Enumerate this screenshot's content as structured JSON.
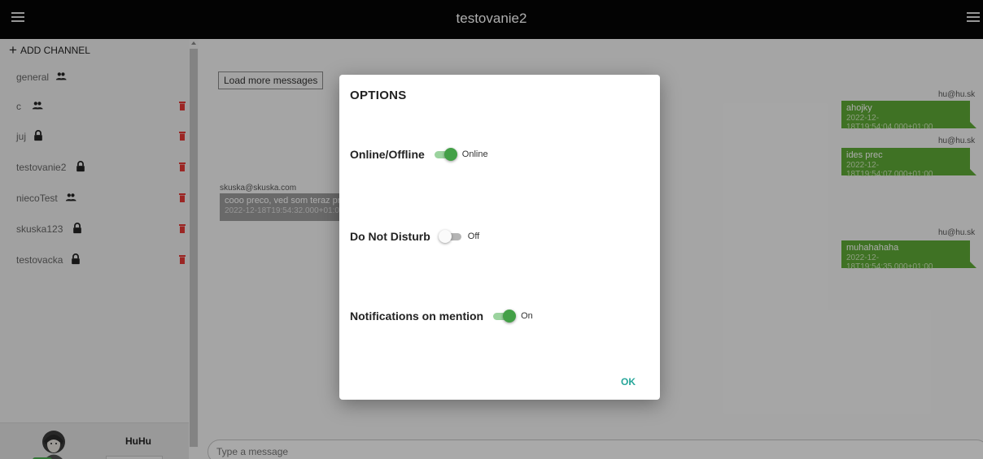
{
  "header": {
    "title": "testovanie2"
  },
  "sidebar": {
    "add_channel_label": "ADD CHANNEL",
    "channels": [
      {
        "name": "general",
        "icon": "group-icon",
        "deletable": false
      },
      {
        "name": "c",
        "icon": "group-icon",
        "deletable": true
      },
      {
        "name": "juj",
        "icon": "lock-icon",
        "deletable": true
      },
      {
        "name": "testovanie2",
        "icon": "lock-icon",
        "deletable": true
      },
      {
        "name": "niecoTest",
        "icon": "group-icon",
        "deletable": true
      },
      {
        "name": "skuska123",
        "icon": "lock-icon",
        "deletable": true
      },
      {
        "name": "testovacka",
        "icon": "lock-icon",
        "deletable": true
      }
    ],
    "user": {
      "name": "HuHu"
    }
  },
  "chat": {
    "load_more_label": "Load more messages",
    "messages": [
      {
        "author": "skuska@skuska.com",
        "text": "cooo preco, ved som teraz pr",
        "time": "2022-12-18T19:54:32.000+01:0",
        "side": "left"
      },
      {
        "author": "hu@hu.sk",
        "text": "ahojky",
        "time": "2022-12-18T19:54:04.000+01:00",
        "side": "right"
      },
      {
        "author": "hu@hu.sk",
        "text": "ides prec",
        "time": "2022-12-18T19:54:07.000+01:00",
        "side": "right"
      },
      {
        "author": "hu@hu.sk",
        "text": "muhahahaha",
        "time": "2022-12-18T19:54:35.000+01:00",
        "side": "right"
      }
    ],
    "input_placeholder": "Type a message"
  },
  "dialog": {
    "title": "OPTIONS",
    "options": [
      {
        "label": "Online/Offline",
        "on": true,
        "state": "Online"
      },
      {
        "label": "Do Not Disturb",
        "on": false,
        "state": "Off"
      },
      {
        "label": "Notifications on mention",
        "on": true,
        "state": "On"
      }
    ],
    "ok_label": "OK"
  },
  "colors": {
    "header_bg": "#050505",
    "bubble_own": "#5ea836",
    "bubble_other": "#9b9b9b",
    "toggle_on": "#43a047",
    "delete_icon": "#e53935",
    "ok_accent": "#26a69a"
  }
}
